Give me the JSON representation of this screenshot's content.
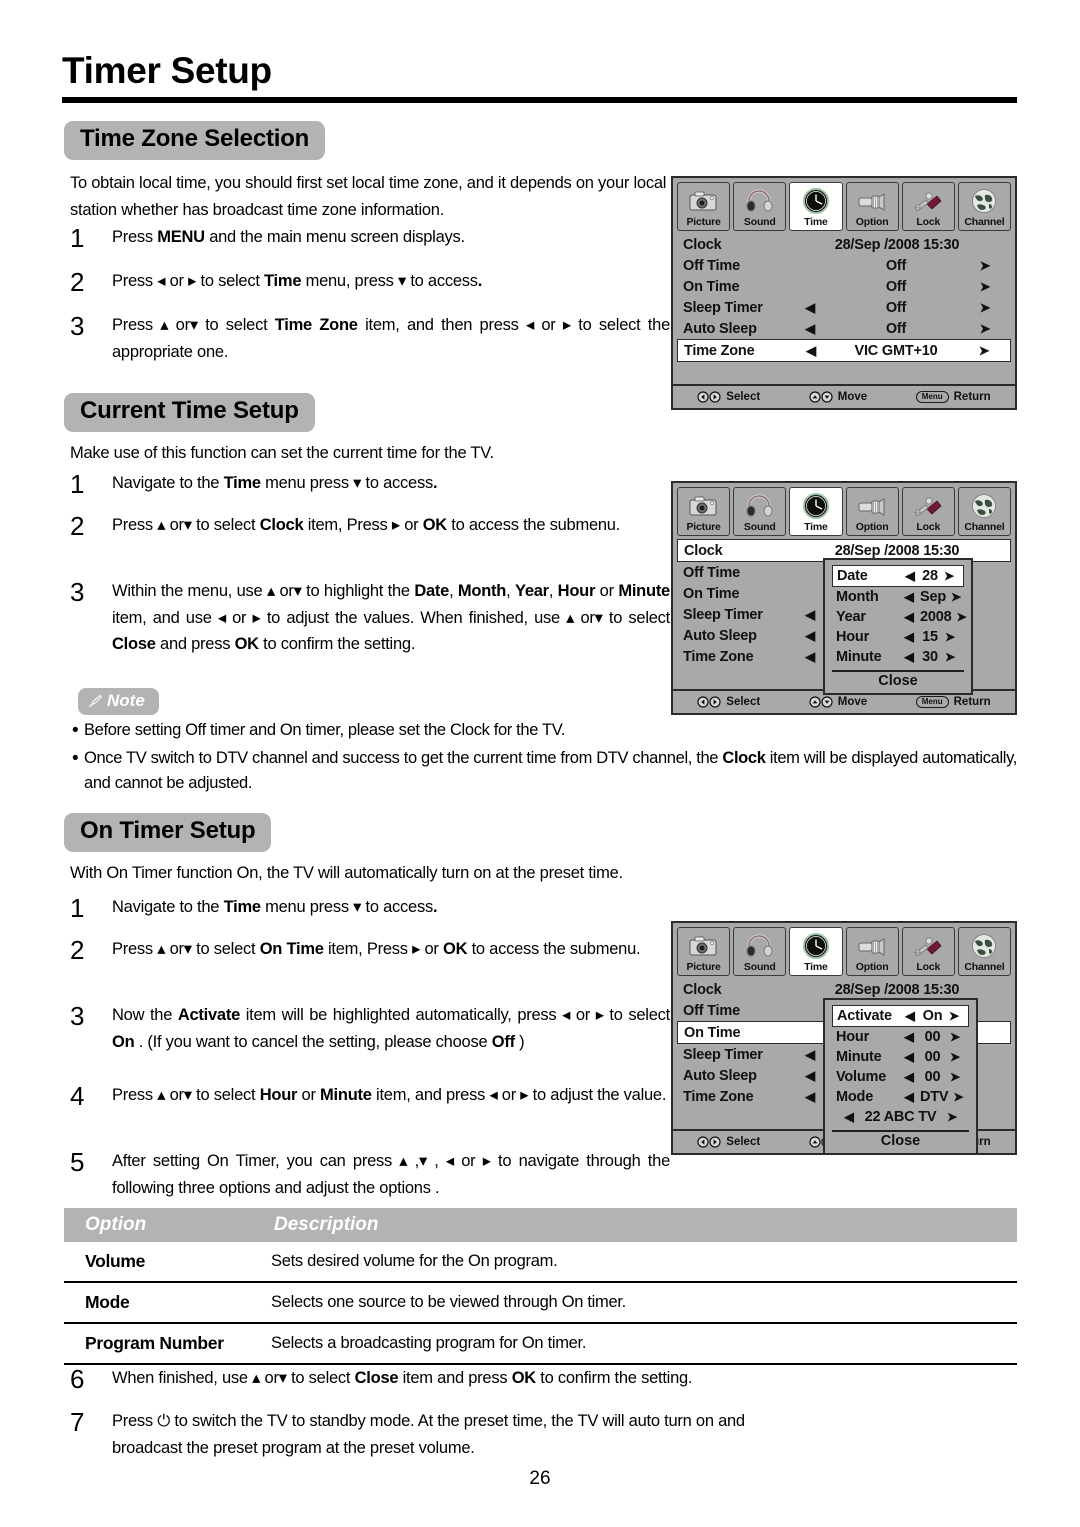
{
  "document": {
    "title": "Timer Setup",
    "page_number": "26"
  },
  "sections": [
    {
      "id": "time_zone_selection",
      "heading": "Time Zone Selection",
      "intro": "To obtain local time, you should first set local time zone, and it depends on your local station whether has broadcast time zone information.",
      "steps": [
        {
          "num": "1",
          "html": "Press <b>MENU</b> and the main menu screen displays."
        },
        {
          "num": "2",
          "html": "Press ◂ or ▸ to select <b>Time</b> menu,  press ▾ to access<b>.</b>"
        },
        {
          "num": "3",
          "html": "Press ▴ or▾  to select <b>Time Zone</b> item, and then press ◂ or ▸ to select the appropriate one."
        }
      ]
    },
    {
      "id": "current_time_setup",
      "heading": "Current Time Setup",
      "intro": "Make use of this function can set the current time for the TV.",
      "steps": [
        {
          "num": "1",
          "html": "Navigate to the <b>Time</b> menu  press ▾  to access<b>.</b>"
        },
        {
          "num": "2",
          "html": "Press  ▴ or▾  to select <b>Clock</b> item, Press ▸ or  <b>OK</b> to access the submenu."
        },
        {
          "num": "3",
          "html": "Within the menu, use ▴ or▾  to highlight the <b>Date</b>, <b>Month</b>, <b>Year</b>, <b>Hour</b> or <b>Minute</b> item, and use ◂ or ▸ to adjust the values. When finished, use  ▴ or▾  to select <b>Close</b> and press <b>OK</b> to confirm the setting."
        }
      ]
    },
    {
      "id": "on_timer_setup",
      "heading": "On Timer Setup",
      "intro": "With On Timer function On, the TV will automatically turn on at the preset time.",
      "steps": [
        {
          "num": "1",
          "html": "Navigate to the <b>Time</b> menu  press ▾ to access<b>.</b>"
        },
        {
          "num": "2",
          "html": "Press ▴ or▾  to select <b>On Time</b> item, Press  ▸ or <b>OK</b> to access the submenu."
        },
        {
          "num": "3",
          "html": "Now the <b>Activate</b> item will be highlighted automatically, press ◂ or ▸ to select <b>On</b> . (If you want to cancel the setting, please choose <b>Off</b> )"
        },
        {
          "num": "4",
          "html": "Press ▴ or▾  to select <b>Hour</b> or <b>Minute</b> item, and press ◂ or ▸ to adjust the value."
        },
        {
          "num": "5",
          "html": "After setting On Timer, you can press ▴ ,▾ , ◂ or ▸ to navigate through the following three options and adjust the options ."
        }
      ],
      "steps_after_table": [
        {
          "num": "6",
          "html": "When finished, use ▴ or▾ to select <b>Close</b> item and press <b>OK</b> to confirm the setting."
        },
        {
          "num": "7",
          "html": "Press ⏻ to switch the TV to standby mode. At the preset time, the TV will auto turn on and broadcast the preset program at the preset volume."
        }
      ]
    }
  ],
  "note": {
    "label": "Note",
    "items": [
      "Before setting Off timer and On timer, please set the Clock for the TV.",
      "Once TV switch to DTV channel and success to get the current time from DTV channel, the <b>Clock</b> item will be displayed automatically, and cannot be adjusted."
    ]
  },
  "options_table": {
    "headers": [
      "Option",
      "Description"
    ],
    "rows": [
      {
        "option": "Volume",
        "description": "Sets desired volume for the On program."
      },
      {
        "option": "Mode",
        "description": "Selects one source to be viewed through On timer."
      },
      {
        "option": "Program Number",
        "description": "Selects a broadcasting program for On timer."
      }
    ]
  },
  "osd": {
    "tabs": [
      {
        "label": "Picture",
        "icon": "camera-icon",
        "active": false
      },
      {
        "label": "Sound",
        "icon": "headphones-icon",
        "active": false
      },
      {
        "label": "Time",
        "icon": "clock-icon",
        "active": true
      },
      {
        "label": "Option",
        "icon": "connector-icon",
        "active": false
      },
      {
        "label": "Lock",
        "icon": "padlock-icon",
        "active": false
      },
      {
        "label": "Channel",
        "icon": "globe-icon",
        "active": false
      }
    ],
    "footer": {
      "select_label": "Select",
      "move_label": "Move",
      "return_label": "Return",
      "menu_key_label": "Menu"
    },
    "panel1": {
      "rows": [
        {
          "name": "Clock",
          "value": "28/Sep  /2008 15:30",
          "left_arrow": "",
          "right_arrow": "",
          "type": "clock",
          "highlight": false
        },
        {
          "name": "Off Time",
          "value": "Off",
          "left_arrow": "",
          "right_arrow": "➤",
          "type": "item",
          "highlight": false
        },
        {
          "name": "On Time",
          "value": "Off",
          "left_arrow": "",
          "right_arrow": "➤",
          "type": "item",
          "highlight": false
        },
        {
          "name": "Sleep Timer",
          "value": "Off",
          "left_arrow": "◀",
          "right_arrow": "➤",
          "type": "item",
          "highlight": false
        },
        {
          "name": "Auto Sleep",
          "value": "Off",
          "left_arrow": "◀",
          "right_arrow": "➤",
          "type": "item",
          "highlight": false
        },
        {
          "name": "Time Zone",
          "value": "VIC GMT+10",
          "left_arrow": "◀",
          "right_arrow": "➤",
          "type": "item",
          "highlight": true
        }
      ]
    },
    "panel2": {
      "rows": [
        {
          "name": "Clock",
          "value": "28/Sep  /2008 15:30",
          "left_arrow": "",
          "right_arrow": "",
          "type": "clock",
          "highlight": true
        },
        {
          "name": "Off Time",
          "value": "",
          "left_arrow": "",
          "right_arrow": "",
          "type": "item",
          "highlight": false
        },
        {
          "name": "On Time",
          "value": "",
          "left_arrow": "",
          "right_arrow": "",
          "type": "item",
          "highlight": false
        },
        {
          "name": "Sleep Timer",
          "value": "",
          "left_arrow": "◀",
          "right_arrow": "",
          "type": "item",
          "highlight": false
        },
        {
          "name": "Auto Sleep",
          "value": "",
          "left_arrow": "◀",
          "right_arrow": "",
          "type": "item",
          "highlight": false
        },
        {
          "name": "Time Zone",
          "value": "",
          "left_arrow": "◀",
          "right_arrow": "",
          "type": "item",
          "highlight": false
        }
      ],
      "submenu": {
        "rows": [
          {
            "name": "Date",
            "value": "28",
            "highlight": true
          },
          {
            "name": "Month",
            "value": "Sep",
            "highlight": false
          },
          {
            "name": "Year",
            "value": "2008",
            "highlight": false
          },
          {
            "name": "Hour",
            "value": "15",
            "highlight": false
          },
          {
            "name": "Minute",
            "value": "30",
            "highlight": false
          }
        ],
        "close_label": "Close",
        "left_arrow": "◀",
        "right_arrow": "➤"
      }
    },
    "panel3": {
      "rows": [
        {
          "name": "Clock",
          "value": "28/Sep  /2008 15:30",
          "left_arrow": "",
          "right_arrow": "",
          "type": "clock",
          "highlight": false
        },
        {
          "name": "Off Time",
          "value": "",
          "left_arrow": "",
          "right_arrow": "",
          "type": "item",
          "highlight": false
        },
        {
          "name": "On Time",
          "value": "",
          "left_arrow": "",
          "right_arrow": "",
          "type": "item",
          "highlight": true
        },
        {
          "name": "Sleep Timer",
          "value": "",
          "left_arrow": "◀",
          "right_arrow": "",
          "type": "item",
          "highlight": false
        },
        {
          "name": "Auto Sleep",
          "value": "",
          "left_arrow": "◀",
          "right_arrow": "",
          "type": "item",
          "highlight": false
        },
        {
          "name": "Time Zone",
          "value": "",
          "left_arrow": "◀",
          "right_arrow": "",
          "type": "item",
          "highlight": false
        }
      ],
      "submenu": {
        "rows": [
          {
            "name": "Activate",
            "value": "On",
            "highlight": true
          },
          {
            "name": "Hour",
            "value": "00",
            "highlight": false
          },
          {
            "name": "Minute",
            "value": "00",
            "highlight": false
          },
          {
            "name": "Volume",
            "value": "00",
            "highlight": false
          },
          {
            "name": "Mode",
            "value": "DTV",
            "highlight": false
          }
        ],
        "program_row": {
          "value": "22 ABC TV"
        },
        "close_label": "Close",
        "left_arrow": "◀",
        "right_arrow": "➤"
      }
    }
  }
}
